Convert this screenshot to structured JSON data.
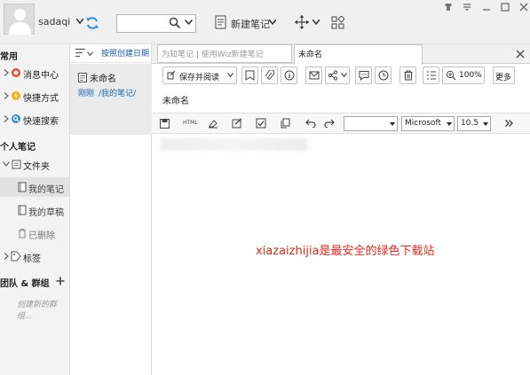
{
  "header": {
    "username": "sadaqi",
    "new_note_label": "新建笔记",
    "search_value": ""
  },
  "sidebar": {
    "section_common": "常用",
    "common_items": [
      {
        "label": "消息中心",
        "icon": "message-center-icon"
      },
      {
        "label": "快捷方式",
        "icon": "shortcut-icon"
      },
      {
        "label": "快速搜索",
        "icon": "quick-search-icon"
      }
    ],
    "section_personal": "个人笔记",
    "folder_label": "文件夹",
    "folder_children": [
      {
        "label": "我的笔记",
        "selected": true
      },
      {
        "label": "我的草稿",
        "selected": false
      },
      {
        "label": "已删除",
        "selected": false
      }
    ],
    "tags_label": "标签",
    "section_team": "团队 & 群组",
    "create_team_hint": "创建新的群组..."
  },
  "note_list": {
    "sort_label": "按照创建日期",
    "notes": [
      {
        "title": "未命名",
        "time": "刚刚",
        "path": "/我的笔记/"
      }
    ]
  },
  "editor": {
    "tag_input_placeholder": "为知笔记 | 使用Wiz新建笔记",
    "active_tab": "未命名",
    "toolbar": {
      "save_read_label": "保存并阅读",
      "zoom_label": "100%",
      "more_label": "更多"
    },
    "note_title": "未命名",
    "format": {
      "font_name": "Microsoft",
      "font_size": "10.5",
      "style_value": ""
    },
    "body_text": "xiazaizhijia是最安全的绿色下载站"
  },
  "colors": {
    "accent_blue": "#1a6ab0",
    "watermark_red": "#e8281c",
    "sidebar_bg": "#f3f3f3",
    "selected_bg": "#e2e2e2"
  }
}
